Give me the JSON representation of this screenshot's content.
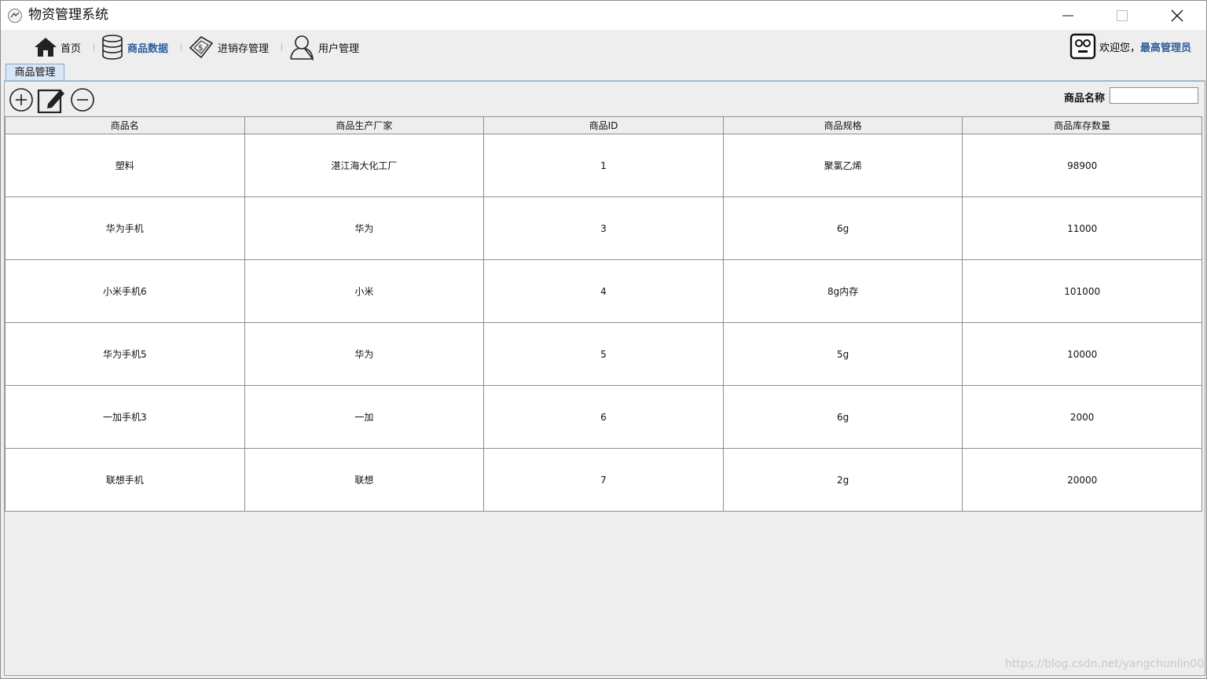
{
  "window": {
    "title": "物资管理系统"
  },
  "nav": {
    "items": [
      {
        "label": "首页",
        "icon": "home-icon"
      },
      {
        "label": "商品数据",
        "icon": "database-icon",
        "active": true
      },
      {
        "label": "进销存管理",
        "icon": "money-icon"
      },
      {
        "label": "用户管理",
        "icon": "user-icon"
      }
    ],
    "welcome": "欢迎您，",
    "user": "最高管理员"
  },
  "tab": {
    "label": "商品管理"
  },
  "toolbar": {
    "add": "add-icon",
    "edit": "edit-icon",
    "delete": "remove-icon"
  },
  "search": {
    "label": "商品名称",
    "value": ""
  },
  "table": {
    "columns": [
      "商品名",
      "商品生产厂家",
      "商品ID",
      "商品规格",
      "商品库存数量"
    ],
    "rows": [
      [
        "塑料",
        "湛江海大化工厂",
        "1",
        "聚氯乙烯",
        "98900"
      ],
      [
        "华为手机",
        "华为",
        "3",
        "6g",
        "11000"
      ],
      [
        "小米手机6",
        "小米",
        "4",
        "8g内存",
        "101000"
      ],
      [
        "华为手机5",
        "华为",
        "5",
        "5g",
        "10000"
      ],
      [
        "一加手机3",
        "一加",
        "6",
        "6g",
        "2000"
      ],
      [
        "联想手机",
        "联想",
        "7",
        "2g",
        "20000"
      ]
    ]
  },
  "watermark": "https://blog.csdn.net/yangchunlin00"
}
